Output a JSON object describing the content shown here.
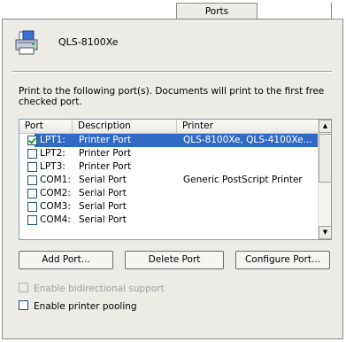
{
  "tabs": [
    {
      "label": "Ports",
      "active": true
    }
  ],
  "printer": {
    "name": "QLS-8100Xe",
    "icon": "printer-icon"
  },
  "description": "Print to the following port(s). Documents will print to the first free checked port.",
  "port_list": {
    "columns": [
      "Port",
      "Description",
      "Printer"
    ],
    "rows": [
      {
        "checked": true,
        "selected": true,
        "port": "LPT1:",
        "description": "Printer Port",
        "printer": "QLS-8100Xe, QLS-4100Xe..."
      },
      {
        "checked": false,
        "selected": false,
        "port": "LPT2:",
        "description": "Printer Port",
        "printer": ""
      },
      {
        "checked": false,
        "selected": false,
        "port": "LPT3:",
        "description": "Printer Port",
        "printer": ""
      },
      {
        "checked": false,
        "selected": false,
        "port": "COM1:",
        "description": "Serial Port",
        "printer": "Generic PostScript Printer"
      },
      {
        "checked": false,
        "selected": false,
        "port": "COM2:",
        "description": "Serial Port",
        "printer": ""
      },
      {
        "checked": false,
        "selected": false,
        "port": "COM3:",
        "description": "Serial Port",
        "printer": ""
      },
      {
        "checked": false,
        "selected": false,
        "port": "COM4:",
        "description": "Serial Port",
        "printer": ""
      }
    ]
  },
  "buttons": {
    "add_port": "Add Port...",
    "delete_port": "Delete Port",
    "configure_port": "Configure Port..."
  },
  "options": {
    "bidirectional": {
      "label": "Enable bidirectional support",
      "checked": false,
      "enabled": false
    },
    "pooling": {
      "label": "Enable printer pooling",
      "checked": false,
      "enabled": true
    }
  },
  "colors": {
    "selection": "#316ac5",
    "panel": "#ecebe6",
    "list_border": "#7f9db9"
  }
}
